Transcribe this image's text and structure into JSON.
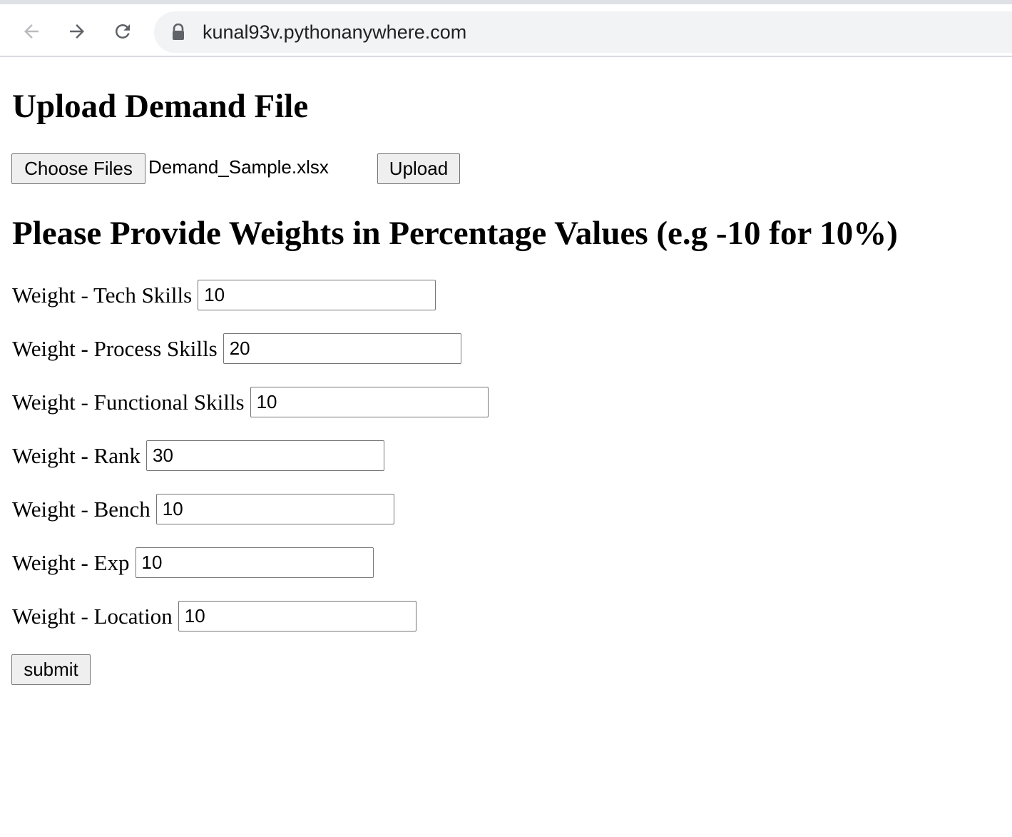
{
  "browser": {
    "url": "kunal93v.pythonanywhere.com"
  },
  "upload_section": {
    "heading": "Upload Demand File",
    "choose_label": "Choose Files",
    "file_name": "Demand_Sample.xlsx",
    "upload_label": "Upload"
  },
  "weights_section": {
    "heading": "Please Provide Weights in Percentage Values (e.g -10 for 10%)",
    "fields": [
      {
        "label": "Weight - Tech Skills",
        "value": "10"
      },
      {
        "label": "Weight - Process Skills",
        "value": "20"
      },
      {
        "label": "Weight - Functional Skills",
        "value": "10"
      },
      {
        "label": "Weight - Rank",
        "value": "30"
      },
      {
        "label": "Weight - Bench",
        "value": "10"
      },
      {
        "label": "Weight - Exp",
        "value": "10"
      },
      {
        "label": "Weight - Location",
        "value": "10"
      }
    ],
    "submit_label": "submit"
  }
}
